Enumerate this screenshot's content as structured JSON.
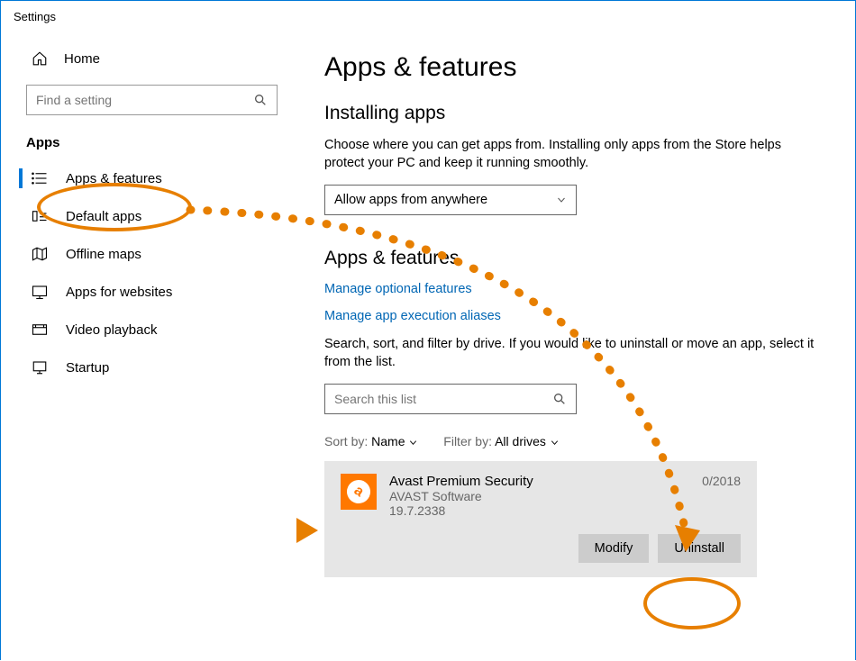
{
  "window": {
    "title": "Settings"
  },
  "sidebar": {
    "home": "Home",
    "search_placeholder": "Find a setting",
    "section": "Apps",
    "items": [
      {
        "label": "Apps & features",
        "icon": "apps-features"
      },
      {
        "label": "Default apps",
        "icon": "default-apps"
      },
      {
        "label": "Offline maps",
        "icon": "offline-maps"
      },
      {
        "label": "Apps for websites",
        "icon": "apps-websites"
      },
      {
        "label": "Video playback",
        "icon": "video"
      },
      {
        "label": "Startup",
        "icon": "startup"
      }
    ]
  },
  "main": {
    "title": "Apps & features",
    "installing_heading": "Installing apps",
    "installing_desc": "Choose where you can get apps from. Installing only apps from the Store helps protect your PC and keep it running smoothly.",
    "install_source": "Allow apps from anywhere",
    "section2_heading": "Apps & features",
    "link_optional": "Manage optional features",
    "link_aliases": "Manage app execution aliases",
    "filter_desc": "Search, sort, and filter by drive. If you would like to uninstall or move an app, select it from the list.",
    "search_list_placeholder": "Search this list",
    "sort_label": "Sort by:",
    "sort_value": "Name",
    "filter_label": "Filter by:",
    "filter_value": "All drives",
    "app": {
      "name": "Avast Premium Security",
      "publisher": "AVAST Software",
      "version": "19.7.2338",
      "date_visible": "0/2018",
      "modify": "Modify",
      "uninstall": "Uninstall"
    }
  }
}
